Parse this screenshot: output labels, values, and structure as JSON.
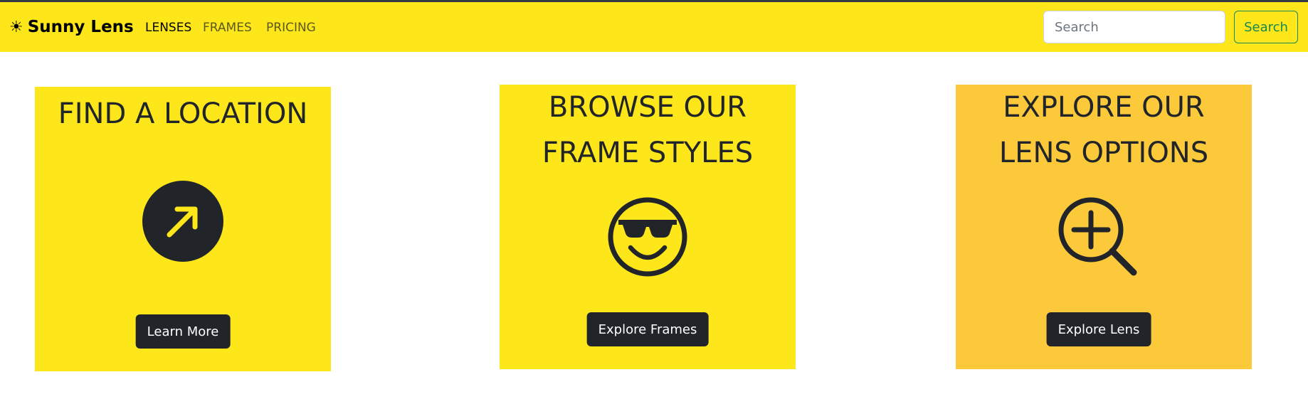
{
  "brand": {
    "icon": "sun-icon",
    "glyph": "☀",
    "name": "Sunny Lens"
  },
  "nav": {
    "items": [
      {
        "label": "LENSES",
        "active": true
      },
      {
        "label": "FRAMES",
        "active": false
      },
      {
        "label": "PRICING",
        "active": false
      }
    ]
  },
  "search": {
    "placeholder": "Search",
    "value": "",
    "button_label": "Search"
  },
  "cards": [
    {
      "title_lines": [
        "FIND A LOCATION"
      ],
      "icon": "arrow-up-right-circle-icon",
      "button_label": "Learn More",
      "bg": "#fde61a"
    },
    {
      "title_lines": [
        "BROWSE OUR",
        "FRAME STYLES"
      ],
      "icon": "sunglasses-smiley-icon",
      "button_label": "Explore Frames",
      "bg": "#fde61a"
    },
    {
      "title_lines": [
        "EXPLORE OUR",
        "LENS OPTIONS"
      ],
      "icon": "zoom-in-icon",
      "button_label": "Explore Lens",
      "bg": "#fcc93b"
    }
  ],
  "colors": {
    "navbar_bg": "#fde61a",
    "card_yellow": "#fde61a",
    "card_amber": "#fcc93b",
    "dark": "#212529",
    "success": "#198754"
  }
}
